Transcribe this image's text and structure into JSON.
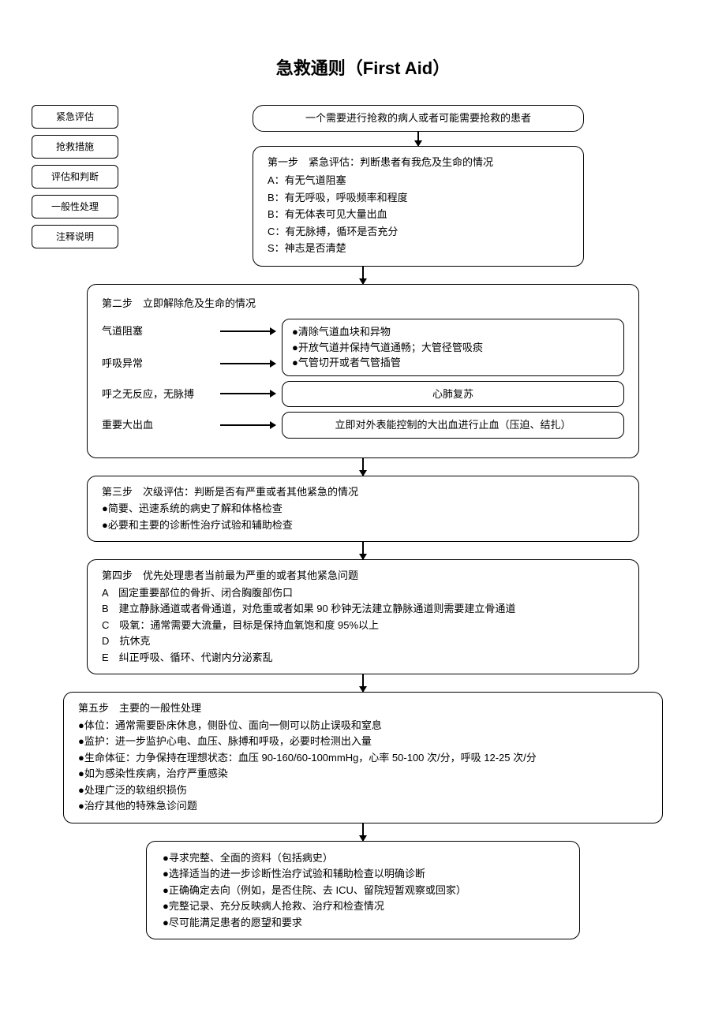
{
  "title": "急救通则（First Aid）",
  "legend": {
    "items": [
      "紧急评估",
      "抢救措施",
      "评估和判断",
      "一般性处理",
      "注释说明"
    ]
  },
  "start": "一个需要进行抢救的病人或者可能需要抢救的患者",
  "step1": {
    "header": "第一步　紧急评估：判断患者有我危及生命的情况",
    "lines": [
      "A：有无气道阻塞",
      "B：有无呼吸，呼吸频率和程度",
      "B：有无体表可见大量出血",
      "C：有无脉搏，循环是否充分",
      "S：神志是否清楚"
    ]
  },
  "step2": {
    "header": "第二步　立即解除危及生命的情况",
    "rows": [
      {
        "label": "气道阻塞",
        "target": [
          "●清除气道血块和异物",
          "●开放气道并保持气道通畅；大管径管吸痰",
          "●气管切开或者气管插管"
        ],
        "center": false,
        "shared": true
      },
      {
        "label": "呼吸异常",
        "target": null,
        "shared_with_prev": true
      },
      {
        "label": "呼之无反应，无脉搏",
        "target": [
          "心肺复苏"
        ],
        "center": true
      },
      {
        "label": "重要大出血",
        "target": [
          "立即对外表能控制的大出血进行止血（压迫、结扎）"
        ],
        "center": true
      }
    ]
  },
  "step3": {
    "header": "第三步　次级评估：判断是否有严重或者其他紧急的情况",
    "lines": [
      "●简要、迅速系统的病史了解和体格检查",
      "●必要和主要的诊断性治疗试验和辅助检查"
    ]
  },
  "step4": {
    "header": "第四步　优先处理患者当前最为严重的或者其他紧急问题",
    "lines": [
      "A　固定重要部位的骨折、闭合胸腹部伤口",
      "B　建立静脉通道或者骨通道，对危重或者如果 90 秒钟无法建立静脉通道则需要建立骨通道",
      "C　吸氧：通常需要大流量，目标是保持血氧饱和度 95%以上",
      "D　抗休克",
      "E　纠正呼吸、循环、代谢内分泌紊乱"
    ]
  },
  "step5": {
    "header": "第五步　主要的一般性处理",
    "lines": [
      "●体位：通常需要卧床休息，侧卧位、面向一侧可以防止误吸和窒息",
      "●监护：进一步监护心电、血压、脉搏和呼吸，必要时检测出入量",
      "●生命体征：力争保持在理想状态：血压 90-160/60-100mmHg，心率 50-100 次/分，呼吸 12-25 次/分",
      "●如为感染性疾病，治疗严重感染",
      "●处理广泛的软组织损伤",
      "●治疗其他的特殊急诊问题"
    ]
  },
  "step6": {
    "lines": [
      "●寻求完整、全面的资料（包括病史）",
      "●选择适当的进一步诊断性治疗试验和辅助检查以明确诊断",
      "●正确确定去向（例如，是否住院、去 ICU、留院短暂观察或回家）",
      "●完整记录、充分反映病人抢救、治疗和检查情况",
      "●尽可能满足患者的愿望和要求"
    ]
  }
}
